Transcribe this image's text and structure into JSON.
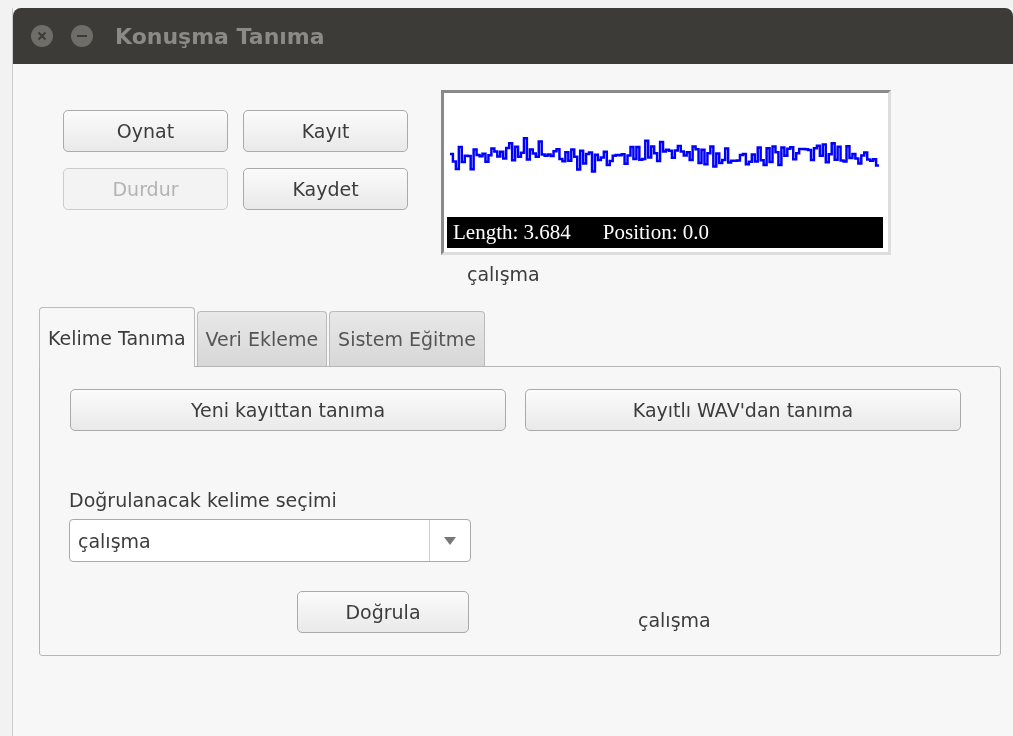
{
  "window": {
    "title": "Konuşma Tanıma"
  },
  "controls": [
    {
      "label": "Oynat",
      "disabled": false
    },
    {
      "label": "Kayıt",
      "disabled": false
    },
    {
      "label": "Durdur",
      "disabled": true
    },
    {
      "label": "Kaydet",
      "disabled": false
    }
  ],
  "waveform": {
    "length": "Length: 3.684",
    "position": "Position: 0.0"
  },
  "recognized_word": "çalışma",
  "tabs": [
    {
      "label": "Kelime Tanıma",
      "selected": true
    },
    {
      "label": "Veri Ekleme",
      "selected": false
    },
    {
      "label": "Sistem Eğitme",
      "selected": false
    }
  ],
  "tab_panel": {
    "buttons": [
      "Yeni kayıttan tanıma",
      "Kayıtlı WAV'dan tanıma"
    ],
    "select_label": "Doğrulanacak kelime seçimi",
    "select_value": "çalışma",
    "verify_button": "Doğrula",
    "result": "çalışma"
  }
}
